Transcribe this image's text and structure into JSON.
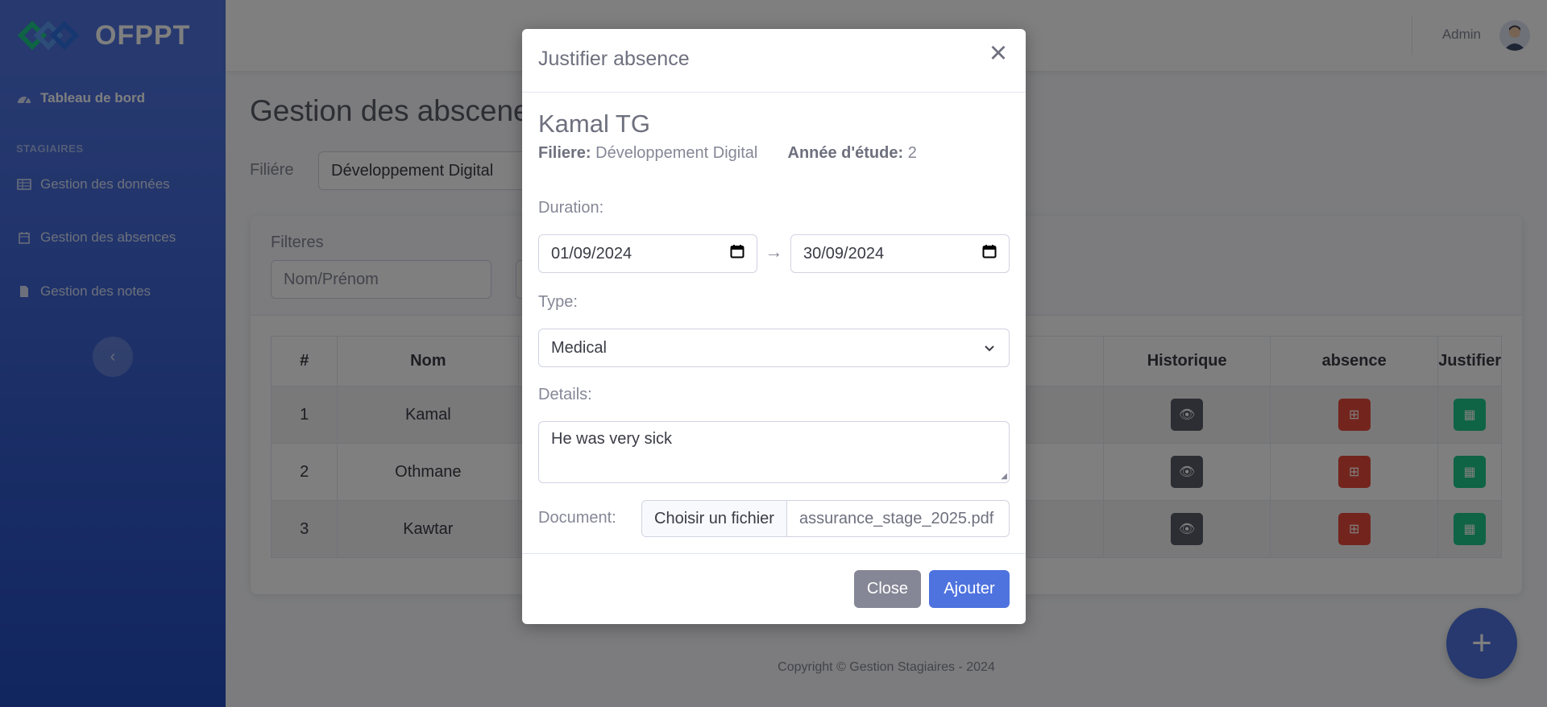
{
  "sidebar": {
    "brand": "OFPPT",
    "items": [
      {
        "label": "Tableau de bord",
        "icon": "tachometer-icon"
      },
      {
        "label": "Gestion des données",
        "icon": "table-icon"
      },
      {
        "label": "Gestion des absences",
        "icon": "calendar-icon"
      },
      {
        "label": "Gestion des notes",
        "icon": "file-icon"
      }
    ],
    "heading": "Stagiaires"
  },
  "topbar": {
    "user": "Admin"
  },
  "page": {
    "title": "Gestion des abscenes",
    "filiere_label": "Filiére",
    "filiere_value": "Développement Digital",
    "filters_label": "Filteres",
    "search_placeholder": "Nom/Prénom"
  },
  "table": {
    "headers": [
      "#",
      "Nom",
      "Historique",
      "absence",
      "Justifier"
    ],
    "rows": [
      {
        "num": "1",
        "nom": "Kamal"
      },
      {
        "num": "2",
        "nom": "Othmane"
      },
      {
        "num": "3",
        "nom": "Kawtar"
      }
    ]
  },
  "footer": "Copyright © Gestion Stagiaires - 2024",
  "modal": {
    "title": "Justifier absence",
    "student_name": "Kamal TG",
    "filiere_key": "Filiere:",
    "filiere_value": "Développement Digital",
    "annee_key": "Année d'étude:",
    "annee_value": "2",
    "duration_label": "Duration:",
    "date_from": "01/09/2024",
    "date_to": "30/09/2024",
    "type_label": "Type:",
    "type_value": "Medical",
    "details_label": "Details:",
    "details_value": "He was very sick",
    "document_label": "Document:",
    "file_button": "Choisir un fichier",
    "file_name": "assurance_stage_2025.pdf",
    "close_label": "Close",
    "add_label": "Ajouter"
  },
  "colors": {
    "primary": "#4e73df",
    "danger": "#e74a3b",
    "success": "#1cc88a",
    "secondary": "#858796"
  }
}
